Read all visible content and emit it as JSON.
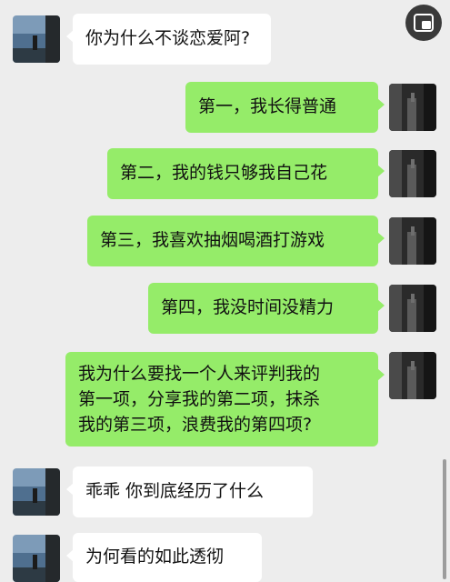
{
  "messages": [
    {
      "side": "left",
      "text": "你为什么不谈恋爱阿?"
    },
    {
      "side": "right",
      "text": "第一，我长得普通"
    },
    {
      "side": "right",
      "text": "第二，我的钱只够我自己花"
    },
    {
      "side": "right",
      "text": "第三，我喜欢抽烟喝酒打游戏"
    },
    {
      "side": "right",
      "text": "第四，我没时间没精力"
    },
    {
      "side": "right",
      "lines": [
        "我为什么要找一个人来评判我的",
        "第一项，分享我的第二项，抹杀",
        "我的第三项，浪费我的第四项?"
      ]
    },
    {
      "side": "left",
      "text": "乖乖 你到底经历了什么"
    },
    {
      "side": "left",
      "text": "为何看的如此透彻"
    }
  ],
  "icons": {
    "floating_button": "picture-in-picture-icon",
    "left_avatar": "seaside-avatar",
    "right_avatar": "dark-street-avatar"
  },
  "colors": {
    "background": "#ededed",
    "received_bubble": "#ffffff",
    "sent_bubble": "#95ec69"
  }
}
